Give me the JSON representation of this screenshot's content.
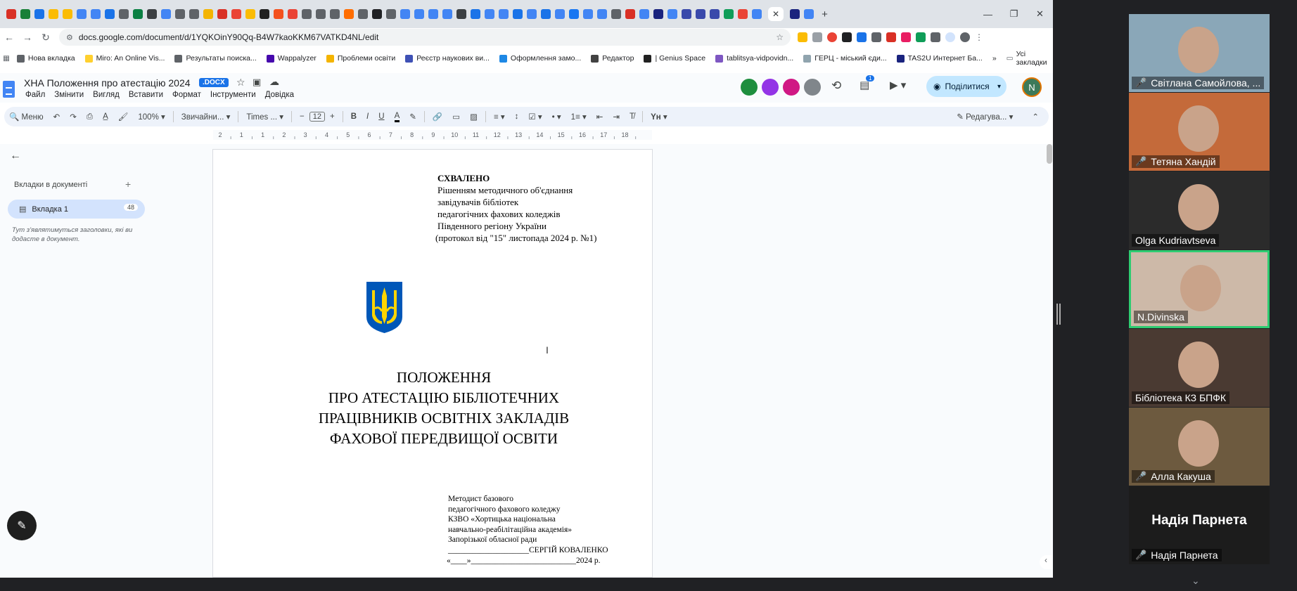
{
  "browser": {
    "window_controls": {
      "minimize": "—",
      "restore": "❐",
      "close": "✕"
    },
    "tab_close": "✕",
    "new_tab": "+",
    "nav": {
      "back": "←",
      "forward": "→",
      "reload": "↻"
    },
    "url": "docs.google.com/document/d/1YQKOinY90Qq-B4W7kaoKKM67VATKD4NL/edit",
    "bookmarks": [
      {
        "label": "Нова вкладка",
        "color": "#5f6368"
      },
      {
        "label": "Miro: An Online Vis...",
        "color": "#ffd02f"
      },
      {
        "label": "Результаты поиска...",
        "color": "#5f6368"
      },
      {
        "label": "Wappalyzer",
        "color": "#4608ad"
      },
      {
        "label": "Проблеми освіти",
        "color": "#f4b400"
      },
      {
        "label": "Реєстр наукових ви...",
        "color": "#3f51b5"
      },
      {
        "label": "Оформлення замо...",
        "color": "#1e88e5"
      },
      {
        "label": "Редактор",
        "color": "#424242"
      },
      {
        "label": "| Genius Space",
        "color": "#212121"
      },
      {
        "label": "tablitsya-vidpovidn...",
        "color": "#7e57c2"
      },
      {
        "label": "ГЕРЦ - міський єди...",
        "color": "#90a4ae"
      },
      {
        "label": "TAS2U Интернет Ба...",
        "color": "#1a237e"
      }
    ],
    "bookmarks_more": "»",
    "all_bookmarks": "Усі закладки"
  },
  "docs": {
    "title": "ХНА Положення про атестацію 2024",
    "badge": ".DOCX",
    "menu": [
      "Файл",
      "Змінити",
      "Вигляд",
      "Вставити",
      "Формат",
      "Інструменти",
      "Довідка"
    ],
    "share_label": "Поділитися",
    "avatar_letter": "N",
    "notification_count": "1",
    "toolbar": {
      "menu_label": "Меню",
      "zoom": "100%",
      "style": "Звичайни...",
      "font": "Times ...",
      "font_size": "12",
      "editing_mode": "Редагува..."
    },
    "ruler_ticks": [
      "2",
      "1",
      "1",
      "2",
      "3",
      "4",
      "5",
      "6",
      "7",
      "8",
      "9",
      "10",
      "11",
      "12",
      "13",
      "14",
      "15",
      "16",
      "17",
      "18"
    ],
    "sidebar": {
      "heading": "Вкладки в документі",
      "tab_name": "Вкладка 1",
      "tab_count": "48",
      "hint": "Тут з'являтимуться заголовки, які ви додасте в документ."
    },
    "page": {
      "approved_title": "СХВАЛЕНО",
      "approved_lines": [
        "Рішенням методичного об'єднання",
        "завідувачів бібліотек",
        "педагогічних фахових коледжів",
        "Південного регіону України"
      ],
      "approved_protocol": "(протокол від \"15\" листопада 2024 р. №1)",
      "title_lines": [
        "ПОЛОЖЕННЯ",
        "ПРО АТЕСТАЦІЮ БІБЛІОТЕЧНИХ",
        "ПРАЦІВНИКІВ ОСВІТНІХ ЗАКЛАДІВ",
        "ФАХОВОЇ ПЕРЕДВИЩОЇ ОСВІТИ"
      ],
      "signature_lines": [
        "Методист базового",
        "педагогічного фахового коледжу",
        "КЗВО «Хортицька національна",
        "навчально-реабілітаційна академія»",
        "Запорізької обласної ради"
      ],
      "signature_name": "____________________СЕРГІЙ КОВАЛЕНКО",
      "signature_date": "«____»__________________________2024 р."
    }
  },
  "meeting": {
    "participants": [
      {
        "name": "Світлана Самойлова, ...",
        "muted": true,
        "bg": "#8aa7b8"
      },
      {
        "name": "Тетяна Хандій",
        "muted": true,
        "bg": "#c46a3a"
      },
      {
        "name": "Olga Kudriavtseva",
        "muted": false,
        "bg": "#2b2b2b"
      },
      {
        "name": "N.Divinska",
        "muted": false,
        "bg": "#cdb9a8"
      },
      {
        "name": "Бібліотека КЗ БПФК",
        "muted": false,
        "bg": "#4a3a32"
      },
      {
        "name": "Алла Какуша",
        "muted": true,
        "bg": "#6d5a3f"
      }
    ],
    "name_only_participant": {
      "display": "Надія Парнета",
      "name": "Надія Парнета",
      "muted": true
    },
    "muted_glyph": "🎤",
    "more": "⌄"
  }
}
